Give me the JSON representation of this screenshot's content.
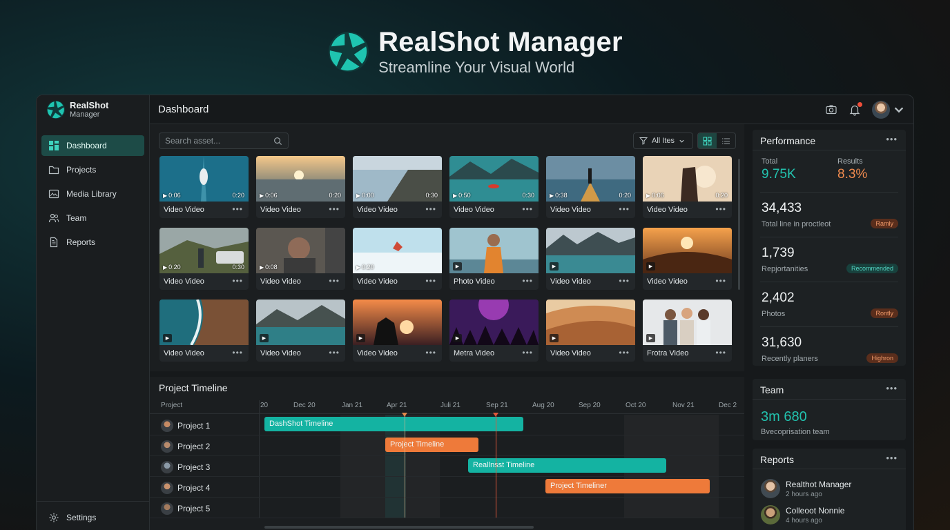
{
  "hero": {
    "title": "RealShot Manager",
    "subtitle": "Streamline Your Visual World"
  },
  "sidebar": {
    "brand_line1": "RealShot",
    "brand_line2": "Manager",
    "items": [
      {
        "label": "Dashboard",
        "icon": "dashboard-icon",
        "active": true
      },
      {
        "label": "Projects",
        "icon": "folder-icon"
      },
      {
        "label": "Media Library",
        "icon": "media-icon"
      },
      {
        "label": "Team",
        "icon": "team-icon"
      },
      {
        "label": "Reports",
        "icon": "reports-icon"
      }
    ],
    "settings_label": "Settings"
  },
  "topbar": {
    "title": "Dashboard"
  },
  "assets": {
    "search_placeholder": "Search asset...",
    "filter_label": "All Ites",
    "cards": [
      {
        "label": "Video Video",
        "start": "0:06",
        "end": "0:20",
        "scene": "boat"
      },
      {
        "label": "Video Video",
        "start": "0:06",
        "end": "0:20",
        "scene": "sunset-sea"
      },
      {
        "label": "Video Video",
        "start": "0:00",
        "end": "0:30",
        "scene": "coast"
      },
      {
        "label": "Video Video",
        "start": "0:50",
        "end": "0:30",
        "scene": "lake-kayak"
      },
      {
        "label": "Video Video",
        "start": "0:38",
        "end": "0:20",
        "scene": "canoe-person"
      },
      {
        "label": "Video Video",
        "start": "0:06",
        "end": "0:20",
        "scene": "photographer"
      },
      {
        "label": "Video Video",
        "start": "0:20",
        "end": "0:30",
        "scene": "van-couple"
      },
      {
        "label": "Video Video",
        "start": "0:08",
        "end": "",
        "scene": "portrait-man"
      },
      {
        "label": "Video Video",
        "start": "0:20",
        "end": "",
        "scene": "snow-jump"
      },
      {
        "label": "Photo Video",
        "start": "",
        "end": "",
        "scene": "monk"
      },
      {
        "label": "Video Video",
        "start": "",
        "end": "",
        "scene": "fjord"
      },
      {
        "label": "Video Video",
        "start": "",
        "end": "",
        "scene": "desert-sunset"
      },
      {
        "label": "Video Video",
        "start": "",
        "end": "",
        "scene": "aerial-coast"
      },
      {
        "label": "Video Video",
        "start": "",
        "end": "",
        "scene": "mountain-lake"
      },
      {
        "label": "Video Video",
        "start": "",
        "end": "",
        "scene": "silhouette"
      },
      {
        "label": "Metra Video",
        "start": "",
        "end": "",
        "scene": "concert"
      },
      {
        "label": "Video Video",
        "start": "",
        "end": "",
        "scene": "dunes"
      },
      {
        "label": "Frotra Video",
        "start": "",
        "end": "",
        "scene": "friends"
      }
    ]
  },
  "timeline": {
    "title": "Project Timeline",
    "col_label": "Project",
    "months": [
      "20",
      "Dec 20",
      "Jan 21",
      "Apr 21",
      "Juli 21",
      "Sep 21",
      "Aug 20",
      "Sep 20",
      "Oct 20",
      "Nov 21",
      "Dec 2"
    ],
    "projects": [
      "Project 1",
      "Project 2",
      "Project 3",
      "Project 4",
      "Project 5"
    ],
    "bars": [
      {
        "label": "DashShot Timeline",
        "color": "teal"
      },
      {
        "label": "Project Timeline",
        "color": "orange"
      },
      {
        "label": "Reallnsst Timeline",
        "color": "teal"
      },
      {
        "label": "Project Timeliner",
        "color": "orange"
      }
    ]
  },
  "performance": {
    "title": "Performance",
    "total_label": "Total",
    "total_value": "9.75K",
    "results_label": "Results",
    "results_value": "8.3%",
    "stats": [
      {
        "value": "34,433",
        "label": "Total line in proctleot",
        "chip": "Ramly",
        "chip_color": "orange"
      },
      {
        "value": "1,739",
        "label": "Repjortanities",
        "chip": "Recommended",
        "chip_color": "teal"
      },
      {
        "value": "2,402",
        "label": "Photos",
        "chip": "Rontly",
        "chip_color": "orange"
      },
      {
        "value": "31,630",
        "label": "Recently planers",
        "chip": "Highron",
        "chip_color": "orange"
      }
    ]
  },
  "team": {
    "title": "Team",
    "value": "3m 680",
    "subtitle": "Bvecoprisation team"
  },
  "reports": {
    "title": "Reports",
    "items": [
      {
        "name": "Realthot Manager",
        "time": "2 hours ago"
      },
      {
        "name": "Colleoot Nonnie",
        "time": "4 hours ago"
      }
    ]
  },
  "colors": {
    "accent": "#14b3a2",
    "orange": "#ee7a3a",
    "active_nav": "#1d4b47"
  }
}
